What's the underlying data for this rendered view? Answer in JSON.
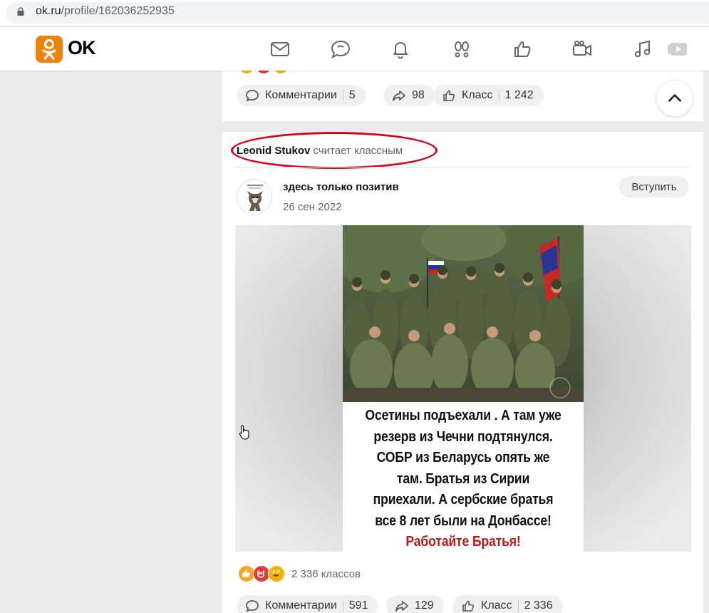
{
  "browser": {
    "url_host": "ok.ru",
    "url_path": "/profile/162036252935"
  },
  "nav": {
    "logo_text": "OK",
    "icons": [
      "mail-icon",
      "chat-icon",
      "bell-icon",
      "guests-icon",
      "likes-icon",
      "camera-icon",
      "music-icon",
      "video-icon"
    ]
  },
  "prev_post": {
    "actions": {
      "comments_label": "Комментарии",
      "comments_count": "5",
      "shares_count": "98",
      "class_label": "Класс",
      "class_count": "1 242"
    }
  },
  "post": {
    "author_name": "Leonid Stukov",
    "author_action": "считает классным",
    "group_name": "здесь только позитив",
    "date": "26 сен 2022",
    "join_label": "Вступить",
    "poster_lines": [
      "Осетины подъехали . А там уже",
      "резерв из Чечни подтянулся.",
      "СОБР из Беларусь опять же",
      "там. Братья из Сирии",
      "приехали. А сербские братья",
      "все 8 лет были на Донбассе!"
    ],
    "poster_highlight": "Работайте Братья!",
    "reactions_count": "2 336 классов",
    "actions": {
      "comments_label": "Комментарии",
      "comments_count": "591",
      "shares_count": "129",
      "class_label": "Класс",
      "class_count": "2 336"
    }
  },
  "colors": {
    "brand": "#ee8208",
    "annotation": "#d9001b",
    "poster_highlight": "#b71c1c"
  }
}
